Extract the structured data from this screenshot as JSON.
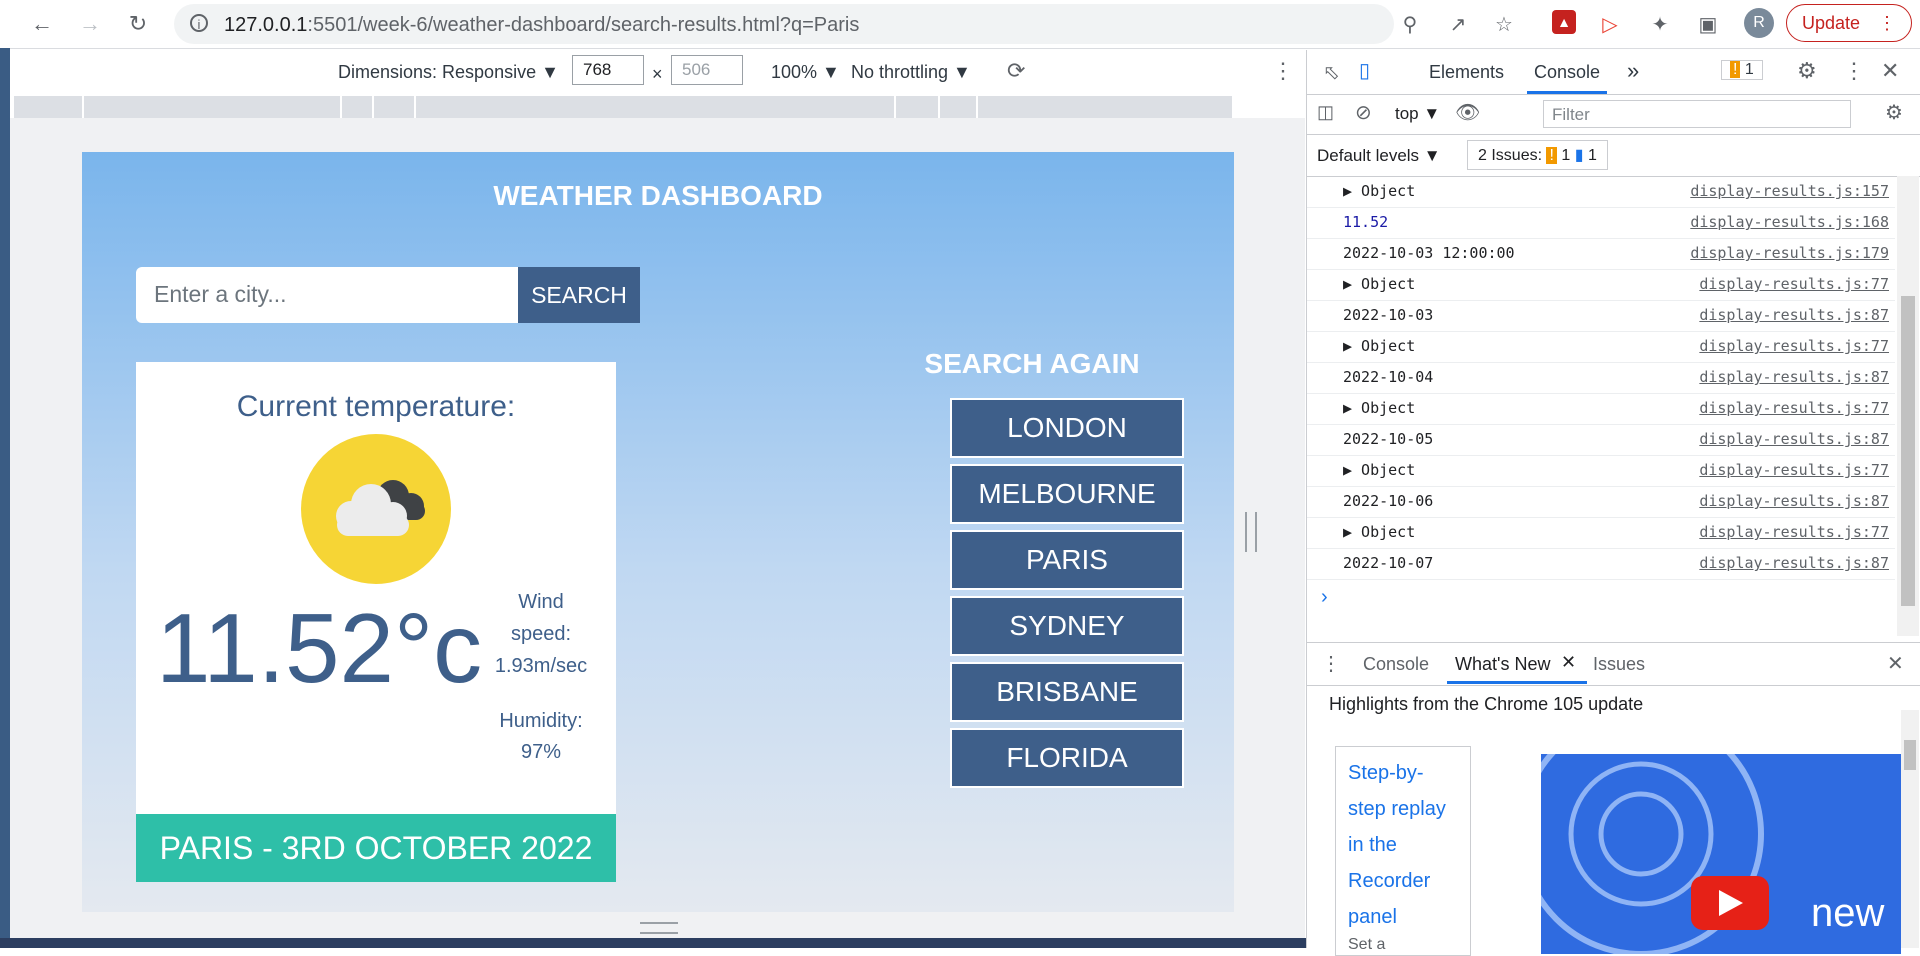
{
  "browser": {
    "url_host": "127.0.0.1",
    "url_rest": ":5501/week-6/weather-dashboard/search-results.html?q=Paris",
    "avatar_letter": "R",
    "update_label": "Update"
  },
  "device_toolbar": {
    "dimensions_label": "Dimensions: Responsive ▼",
    "width_value": "768",
    "times": "×",
    "height_placeholder": "506",
    "zoom_label": "100% ▼",
    "throttle_label": "No throttling ▼"
  },
  "weather": {
    "title": "WEATHER DASHBOARD",
    "search_placeholder": "Enter a city...",
    "search_button": "SEARCH",
    "current_label": "Current temperature:",
    "temperature": "11.52°c",
    "wind_label_1": "Wind",
    "wind_label_2": "speed:",
    "wind_value": "1.93m/sec",
    "humidity_label": "Humidity:",
    "humidity_value": "97%",
    "date_banner": "PARIS - 3RD OCTOBER 2022",
    "search_again": "SEARCH AGAIN",
    "cities": [
      "LONDON",
      "MELBOURNE",
      "PARIS",
      "SYDNEY",
      "BRISBANE",
      "FLORIDA"
    ]
  },
  "devtools": {
    "tab_elements": "Elements",
    "tab_console": "Console",
    "more_tabs": "»",
    "warning_count": "1",
    "context": "top ▼",
    "filter_placeholder": "Filter",
    "default_levels": "Default levels ▼",
    "issues_label": "2 Issues:",
    "issues_warn": "1",
    "issues_info": "1",
    "logs": [
      {
        "msg": "▶ Object",
        "src": "display-results.js:157"
      },
      {
        "msg": "11.52",
        "src": "display-results.js:168"
      },
      {
        "msg": "2022-10-03 12:00:00",
        "src": "display-results.js:179"
      },
      {
        "msg": "▶ Object",
        "src": "display-results.js:77"
      },
      {
        "msg": "2022-10-03",
        "src": "display-results.js:87"
      },
      {
        "msg": "▶ Object",
        "src": "display-results.js:77"
      },
      {
        "msg": "2022-10-04",
        "src": "display-results.js:87"
      },
      {
        "msg": "▶ Object",
        "src": "display-results.js:77"
      },
      {
        "msg": "2022-10-05",
        "src": "display-results.js:87"
      },
      {
        "msg": "▶ Object",
        "src": "display-results.js:77"
      },
      {
        "msg": "2022-10-06",
        "src": "display-results.js:87"
      },
      {
        "msg": "▶ Object",
        "src": "display-results.js:77"
      },
      {
        "msg": "2022-10-07",
        "src": "display-results.js:87"
      }
    ],
    "prompt": "›",
    "drawer_console": "Console",
    "drawer_whatsnew": "What's New",
    "drawer_issues": "Issues",
    "whatsnew_title": "Highlights from the Chrome 105 update",
    "whatsnew_card": "Step-by-step replay in the Recorder panel",
    "whatsnew_card_sub": "Set a",
    "video_text": "new"
  }
}
